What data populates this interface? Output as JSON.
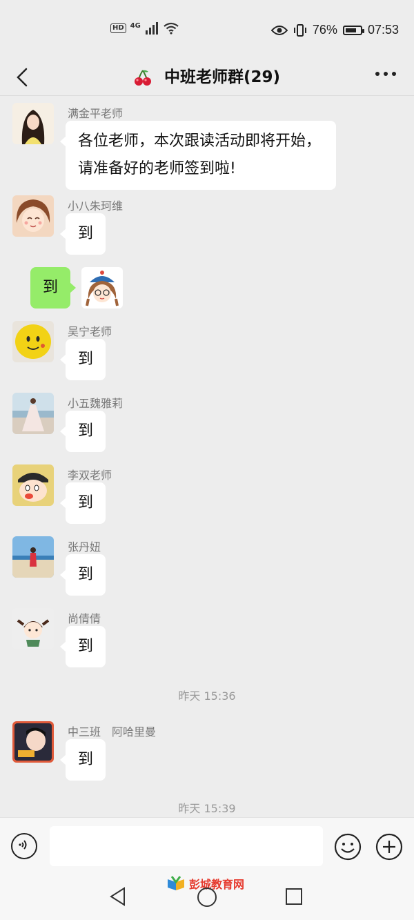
{
  "status_bar": {
    "hd": "HD",
    "network": "4G",
    "battery": "76%",
    "time": "07:53"
  },
  "header": {
    "title": "中班老师群(29)",
    "back_icon": "chevron-left-icon",
    "more_icon": "more-dots-icon",
    "title_emoji": "cherry"
  },
  "messages": [
    {
      "sender": "满金平老师",
      "text": "各位老师，本次跟读活动即将开始，请准备好的老师签到啦!"
    },
    {
      "sender": "小八朱珂维",
      "text": "到"
    },
    {
      "sender": "",
      "text": "到",
      "self": true
    },
    {
      "sender": "吴宁老师",
      "text": "到"
    },
    {
      "sender": "小五魏雅莉",
      "text": "到"
    },
    {
      "sender": "李双老师",
      "text": "到"
    },
    {
      "sender": "张丹妞",
      "text": "到"
    },
    {
      "sender": "尚倩倩",
      "text": "到"
    },
    {
      "sender": "中三班　阿哈里曼",
      "text": "到"
    }
  ],
  "timestamps": [
    "昨天 15:36",
    "昨天 15:39"
  ],
  "input_bar": {
    "placeholder": "",
    "voice_icon": "voice-icon",
    "emoji_icon": "emoji-icon",
    "plus_icon": "plus-icon"
  },
  "watermark": {
    "text": "彭城教育网"
  },
  "colors": {
    "background": "#ededed",
    "self_bubble": "#95ec69",
    "other_bubble": "#ffffff",
    "watermark": "#e63a2e"
  }
}
